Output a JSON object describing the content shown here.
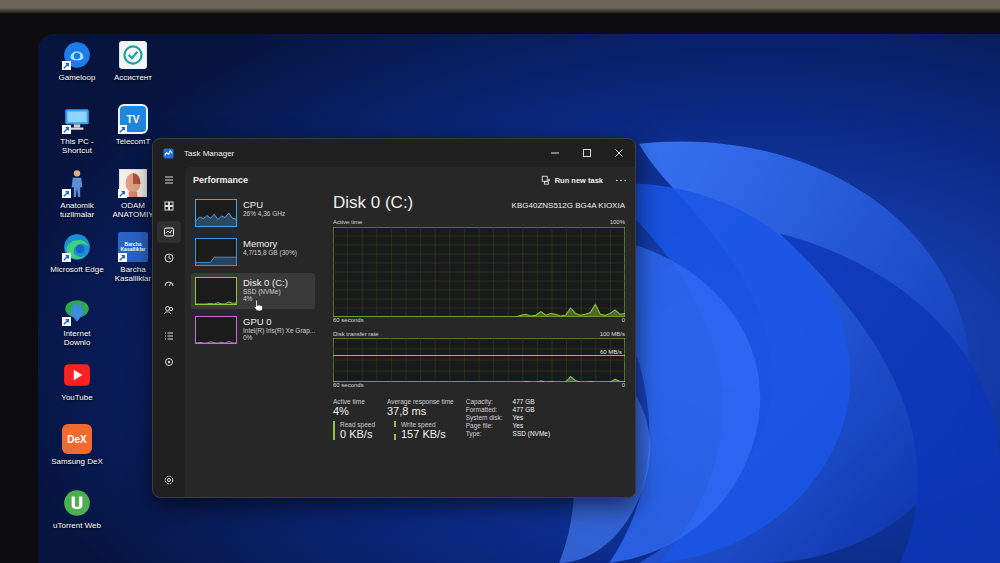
{
  "desktop_icons": [
    {
      "label": "Gameloop",
      "kind": "gameloop",
      "shortcut": true
    },
    {
      "label": "This PC - Shortcut",
      "kind": "pc",
      "shortcut": true
    },
    {
      "label": "Anatomik tuzilmalar",
      "kind": "anatomy",
      "shortcut": true
    },
    {
      "label": "Microsoft Edge",
      "kind": "edge",
      "shortcut": true
    },
    {
      "label": "Internet Downlo",
      "kind": "idm",
      "shortcut": true
    },
    {
      "label": "YouTube",
      "kind": "youtube",
      "shortcut": false
    },
    {
      "label": "Samsung DeX",
      "kind": "dex",
      "shortcut": false,
      "badge": "DeX"
    },
    {
      "label": "uTorrent Web",
      "kind": "utorrent",
      "shortcut": false
    },
    {
      "label": "Ассистент",
      "kind": "assistant",
      "shortcut": false
    },
    {
      "label": "TelecomT",
      "kind": "tv",
      "shortcut": true,
      "badge": "TV"
    },
    {
      "label": "ODAM ANATOMIY",
      "kind": "face",
      "shortcut": true
    },
    {
      "label": "Barcha Kasalliklar",
      "kind": "book",
      "shortcut": true,
      "badge": "Barcha Kasalliklar"
    }
  ],
  "window": {
    "title": "Task Manager"
  },
  "nav": [
    {
      "kind": "menu",
      "selected": false
    },
    {
      "kind": "processes",
      "selected": false
    },
    {
      "kind": "performance",
      "selected": true
    },
    {
      "kind": "history",
      "selected": false
    },
    {
      "kind": "startup",
      "selected": false
    },
    {
      "kind": "users",
      "selected": false
    },
    {
      "kind": "details",
      "selected": false
    },
    {
      "kind": "services",
      "selected": false
    },
    {
      "kind": "settings",
      "selected": false
    }
  ],
  "header": {
    "title": "Performance",
    "run_task": "Run new task"
  },
  "devices": [
    {
      "name": "CPU",
      "lines": [
        "26% 4,36 GHz"
      ],
      "selected": false,
      "color": "#4aa3e8",
      "values": [
        20,
        35,
        28,
        40,
        30,
        45,
        25,
        38,
        33,
        50,
        30,
        26
      ]
    },
    {
      "name": "Memory",
      "lines": [
        "4,7/15,8 GB (30%)"
      ],
      "selected": false,
      "color": "#3f8fdc",
      "values": [
        10,
        10,
        10,
        10,
        10,
        30,
        30,
        30,
        30,
        30,
        30,
        30
      ]
    },
    {
      "name": "Disk 0 (C:)",
      "lines": [
        "SSD (NVMe)",
        "4%"
      ],
      "selected": true,
      "color": "#8dc63f",
      "values": [
        0,
        0,
        0,
        0,
        2,
        0,
        5,
        1,
        0,
        8,
        3,
        4
      ]
    },
    {
      "name": "GPU 0",
      "lines": [
        "Intel(R) Iris(R) Xe Grap...",
        "0%"
      ],
      "selected": false,
      "color": "#c46bd6",
      "values": [
        0,
        2,
        0,
        0,
        5,
        1,
        0,
        3,
        0,
        6,
        1,
        0
      ]
    }
  ],
  "detail": {
    "title": "Disk 0 (C:)",
    "model": "KBG40ZNS512G BG4A KIOXIA"
  },
  "active_chart": {
    "label": "Active time",
    "max_label": "100%",
    "time_label": "60 seconds",
    "min_label": "0",
    "max": 100,
    "values": [
      0,
      0,
      0,
      0,
      0,
      0,
      0,
      0,
      0,
      0,
      0,
      0,
      0,
      0,
      0,
      0,
      0,
      0,
      0,
      0,
      0,
      0,
      0,
      0,
      0,
      0,
      0,
      0,
      0,
      0,
      0,
      0,
      0,
      0,
      0,
      0,
      0,
      0,
      2,
      3,
      1,
      2,
      6,
      2,
      4,
      3,
      1,
      2,
      10,
      4,
      2,
      3,
      5,
      14,
      3,
      2,
      4,
      8,
      3,
      4
    ]
  },
  "transfer_chart": {
    "label": "Disk transfer rate",
    "max_label": "100 MB/s",
    "reference_label": "60 MB/s",
    "reference": 60,
    "time_label": "60 seconds",
    "min_label": "0",
    "max": 100,
    "values": [
      0,
      0,
      0,
      0,
      0,
      0,
      0,
      0,
      0,
      0,
      0,
      0,
      0,
      0,
      0,
      0,
      0,
      0,
      0,
      0,
      0,
      0,
      0,
      0,
      0,
      0,
      0,
      0,
      0,
      0,
      0,
      0,
      0,
      0,
      0,
      0,
      0,
      0,
      0,
      1,
      0,
      0,
      2,
      0,
      1,
      0,
      0,
      0,
      12,
      3,
      0,
      0,
      1,
      0,
      0,
      0,
      0,
      6,
      1,
      0
    ]
  },
  "stats": [
    {
      "label": "Active time",
      "value": "4%"
    },
    {
      "label": "Average response time",
      "value": "37,8 ms"
    }
  ],
  "speeds": [
    {
      "label": "Read speed",
      "value": "0 KB/s",
      "kind": "solid"
    },
    {
      "label": "Write speed",
      "value": "157 KB/s",
      "kind": "dashed"
    }
  ],
  "properties": [
    {
      "label": "Capacity:",
      "value": "477 GB"
    },
    {
      "label": "Formatted:",
      "value": "477 GB"
    },
    {
      "label": "System disk:",
      "value": "Yes"
    },
    {
      "label": "Page file:",
      "value": "Yes"
    },
    {
      "label": "Type:",
      "value": "SSD (NVMe)"
    }
  ]
}
